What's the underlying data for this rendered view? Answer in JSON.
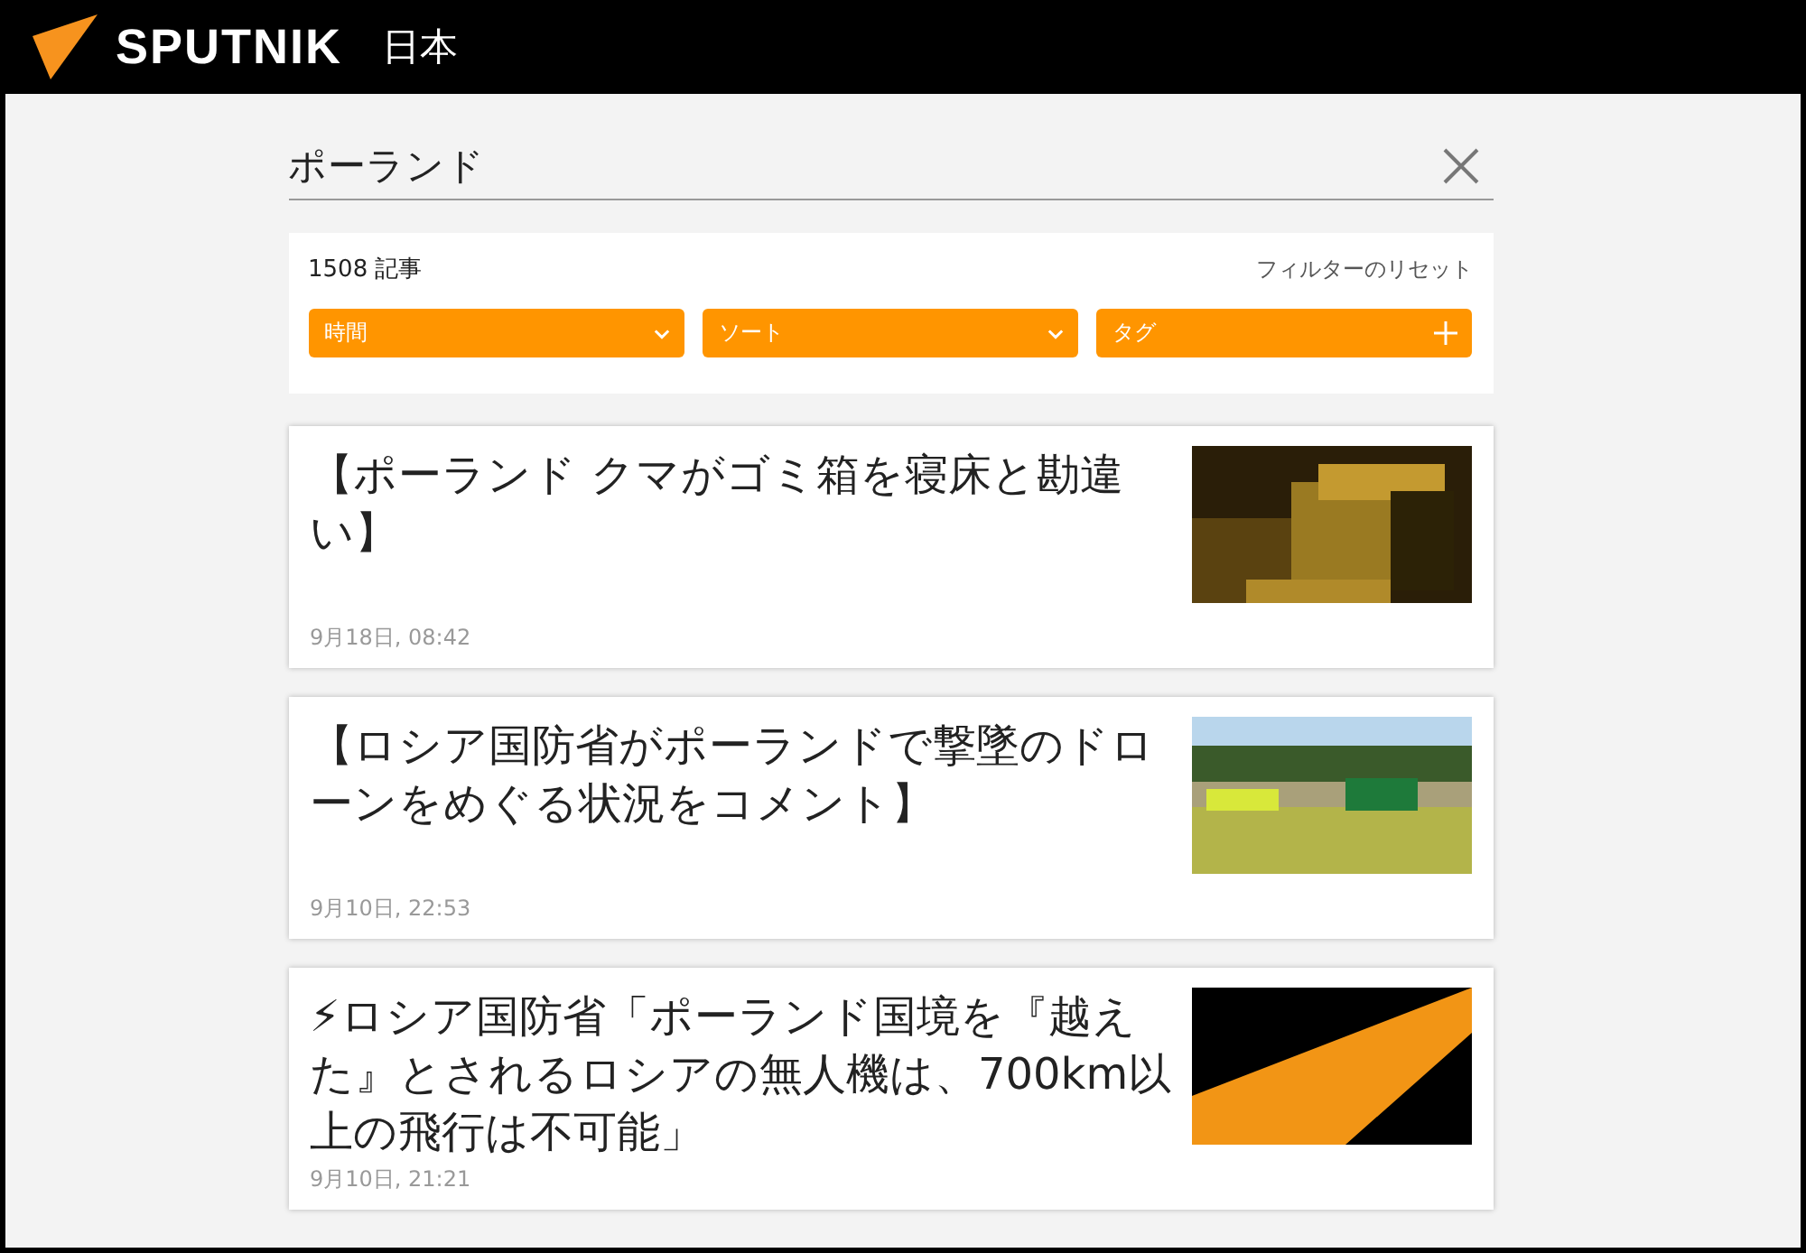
{
  "header": {
    "logo": "SPUTNIK",
    "edition": "日本"
  },
  "search": {
    "value": "ポーランド"
  },
  "filters": {
    "count": "1508 記事",
    "reset": "フィルターのリセット",
    "controls": [
      {
        "label": "時間",
        "kind": "dropdown"
      },
      {
        "label": "ソート",
        "kind": "dropdown"
      },
      {
        "label": "タグ",
        "kind": "add"
      }
    ]
  },
  "articles": [
    {
      "title": "【ポーランド クマがゴミ箱を寝床と勘違い】",
      "date": "9月18日, 08:42"
    },
    {
      "title": "【ロシア国防省がポーランドで撃墜のドローンをめぐる状況をコメント】",
      "date": "9月10日, 22:53"
    },
    {
      "title": "⚡ロシア国防省「ポーランド国境を『越えた』とされるロシアの無人機は、700km以上の飛行は不可能」",
      "date": "9月10日, 21:21"
    }
  ]
}
